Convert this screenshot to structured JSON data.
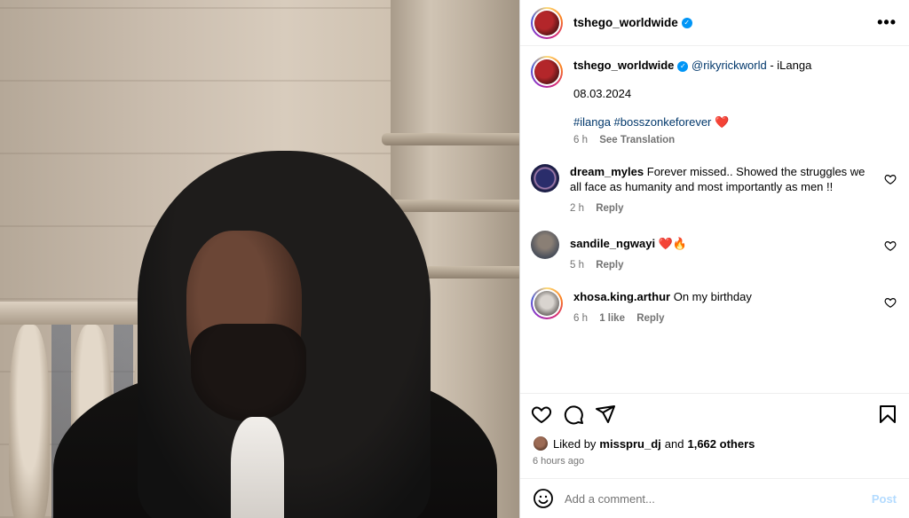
{
  "post": {
    "author": "tshego_worldwide",
    "more_icon": "more-horizontal-icon",
    "caption": {
      "mention": "@rikyrickworld",
      "after_mention": " - iLanga",
      "date": "08.03.2024",
      "hashtags": "#ilanga #bosszonkeforever",
      "emoji": "❤️",
      "time": "6 h",
      "see_translation": "See Translation"
    }
  },
  "comments": [
    {
      "user": "dream_myles",
      "text": "Forever missed.. Showed the struggles we all face as humanity and most importantly as men !!",
      "time": "2 h",
      "likes": "",
      "reply": "Reply"
    },
    {
      "user": "sandile_ngwayi",
      "text": "❤️🔥",
      "time": "5 h",
      "likes": "",
      "reply": "Reply"
    },
    {
      "user": "xhosa.king.arthur",
      "text": "On my birthday",
      "time": "6 h",
      "likes": "1 like",
      "reply": "Reply"
    }
  ],
  "likes": {
    "prefix": "Liked by ",
    "user": "misspru_dj",
    "mid": " and ",
    "others": "1,662 others"
  },
  "posted_ago": "6 hours ago",
  "add_comment": {
    "placeholder": "Add a comment...",
    "post_label": "Post"
  },
  "colors": {
    "link": "#00376b",
    "verified": "#0095f6",
    "post_disabled": "#b3dbff"
  }
}
